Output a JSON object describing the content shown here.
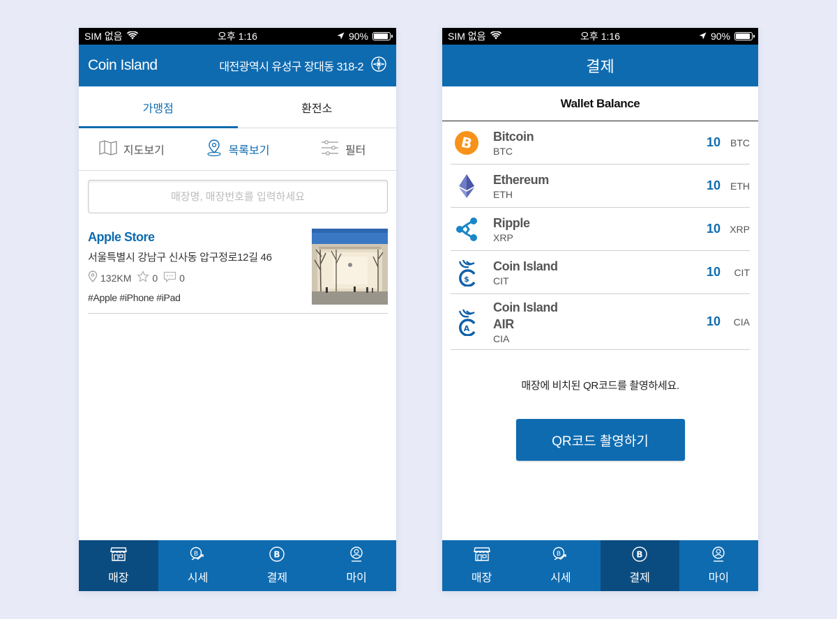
{
  "status_bar": {
    "carrier": "SIM 없음",
    "time": "오후 1:16",
    "battery": "90%",
    "battery_level": 0.9
  },
  "left": {
    "app_title": "Coin Island",
    "address": "대전광역시 유성구 장대동 318-2",
    "tabs": [
      {
        "label": "가맹점",
        "active": true
      },
      {
        "label": "환전소",
        "active": false
      }
    ],
    "view_options": [
      {
        "label": "지도보기",
        "icon": "map-icon"
      },
      {
        "label": "목록보기",
        "icon": "location-pin-icon",
        "active": true
      },
      {
        "label": "필터",
        "icon": "filter-sliders-icon"
      }
    ],
    "search_placeholder": "매장명, 매장번호를 입력하세요",
    "store": {
      "name": "Apple Store",
      "address": "서울특별시 강남구 신사동 압구정로12길 46",
      "distance": "132KM",
      "likes": "0",
      "comments": "0",
      "tags": "#Apple #iPhone #iPad"
    }
  },
  "bottom_nav": [
    {
      "label": "매장",
      "icon": "store-icon"
    },
    {
      "label": "시세",
      "icon": "price-trend-icon"
    },
    {
      "label": "결제",
      "icon": "bitcoin-payment-icon"
    },
    {
      "label": "마이",
      "icon": "user-icon"
    }
  ],
  "right": {
    "title": "결제",
    "wallet_title": "Wallet Balance",
    "coins": [
      {
        "name": "Bitcoin",
        "symbol": "BTC",
        "amount": "10",
        "icon": "bitcoin-icon"
      },
      {
        "name": "Ethereum",
        "symbol": "ETH",
        "amount": "10",
        "icon": "ethereum-icon"
      },
      {
        "name": "Ripple",
        "symbol": "XRP",
        "amount": "10",
        "icon": "ripple-icon"
      },
      {
        "name": "Coin Island",
        "symbol": "CIT",
        "amount": "10",
        "icon": "coin-island-cit-icon"
      },
      {
        "name": "Coin Island AIR",
        "symbol": "CIA",
        "amount": "10",
        "icon": "coin-island-air-icon"
      }
    ],
    "qr_message": "매장에 비치된 QR코드를 촬영하세요.",
    "qr_button": "QR코드 촬영하기"
  },
  "colors": {
    "primary": "#0f6bb0",
    "nav_active": "#0b4c80",
    "bitcoin": "#f7931a"
  }
}
